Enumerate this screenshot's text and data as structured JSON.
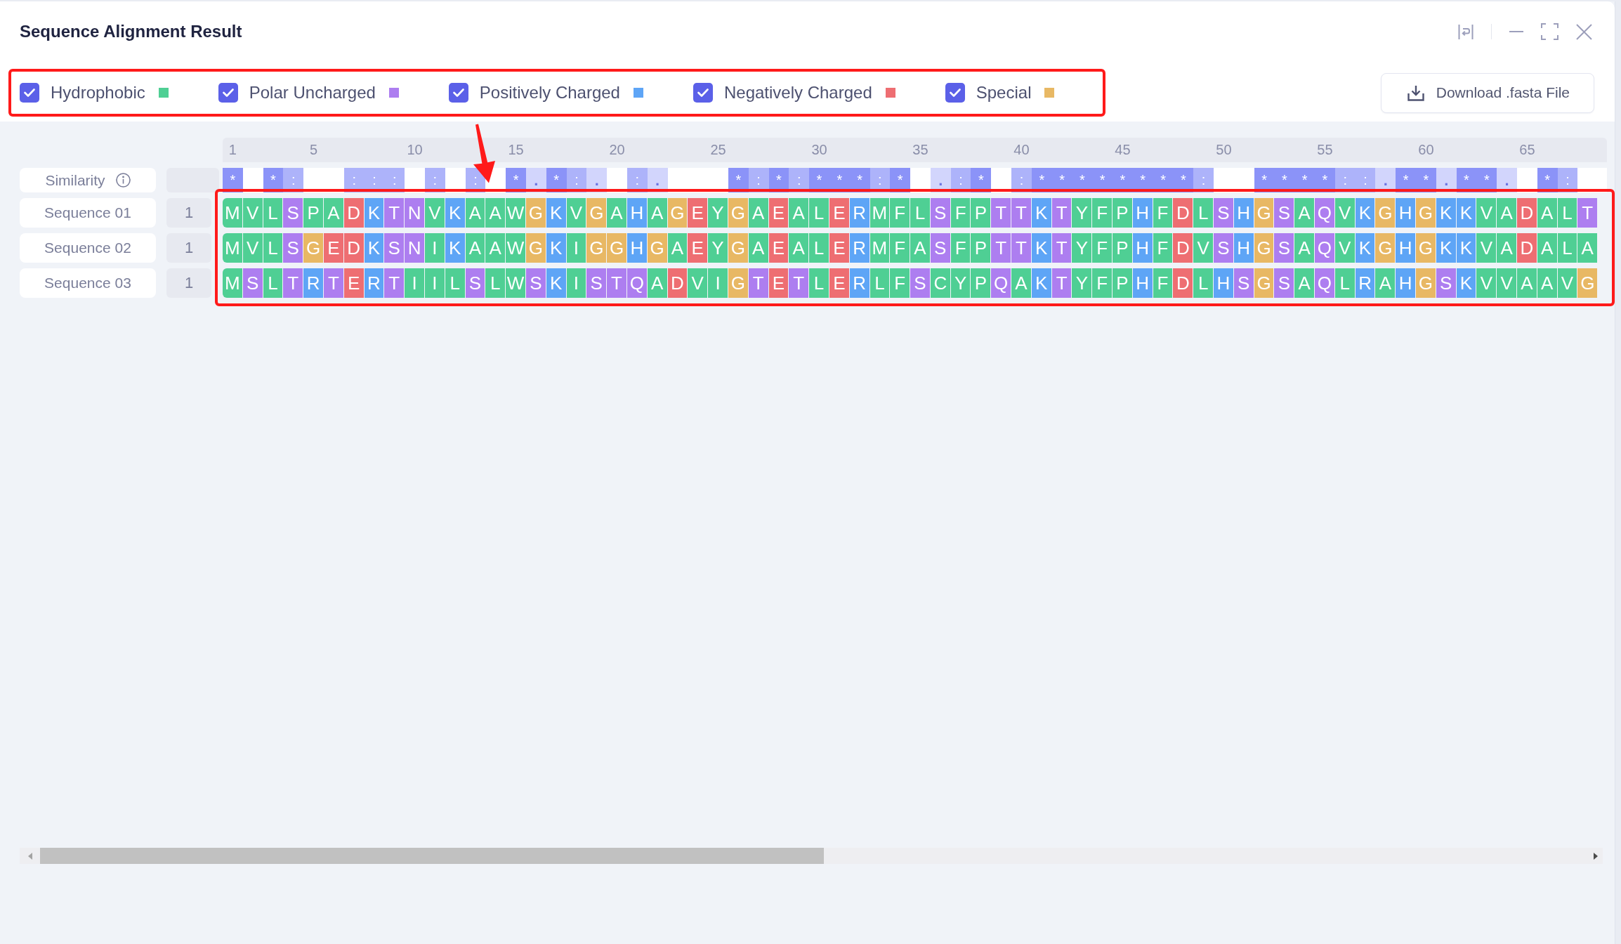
{
  "window": {
    "title": "Sequence Alignment Result"
  },
  "legend": {
    "highlighted": true,
    "items": [
      {
        "label": "Hydrophobic",
        "kind": "hydrophobic",
        "checked": true,
        "color": "#4fcf94"
      },
      {
        "label": "Polar Uncharged",
        "kind": "polar",
        "checked": true,
        "color": "#ad7ef0"
      },
      {
        "label": "Positively Charged",
        "kind": "positive",
        "checked": true,
        "color": "#5ea5f6"
      },
      {
        "label": "Negatively Charged",
        "kind": "negative",
        "checked": true,
        "color": "#ee6e72"
      },
      {
        "label": "Special",
        "kind": "special",
        "checked": true,
        "color": "#e8b864"
      }
    ]
  },
  "download_button": {
    "label": "Download .fasta File"
  },
  "alignment": {
    "highlighted": true,
    "pointer_arrow": true,
    "ruler": [
      "1",
      "5",
      "10",
      "15",
      "20",
      "25",
      "30",
      "35",
      "40",
      "45",
      "50",
      "55",
      "60",
      "65"
    ],
    "similarity": {
      "label": "Similarity",
      "marks": [
        {
          "kind": "identical",
          "mark": "*"
        },
        {
          "kind": "none"
        },
        {
          "kind": "identical",
          "mark": "*"
        },
        {
          "kind": "strong",
          "mark": ":"
        },
        {
          "kind": "none"
        },
        {
          "kind": "none"
        },
        {
          "kind": "strong",
          "mark": ":"
        },
        {
          "kind": "strong",
          "mark": ":"
        },
        {
          "kind": "strong",
          "mark": ":"
        },
        {
          "kind": "none"
        },
        {
          "kind": "strong",
          "mark": ":"
        },
        {
          "kind": "none"
        },
        {
          "kind": "strong",
          "mark": ":"
        },
        {
          "kind": "none"
        },
        {
          "kind": "identical",
          "mark": "*"
        },
        {
          "kind": "weak",
          "mark": "."
        },
        {
          "kind": "identical",
          "mark": "*"
        },
        {
          "kind": "strong",
          "mark": ":"
        },
        {
          "kind": "weak",
          "mark": "."
        },
        {
          "kind": "none"
        },
        {
          "kind": "strong",
          "mark": ":"
        },
        {
          "kind": "weak",
          "mark": "."
        },
        {
          "kind": "none"
        },
        {
          "kind": "none"
        },
        {
          "kind": "none"
        },
        {
          "kind": "identical",
          "mark": "*"
        },
        {
          "kind": "strong",
          "mark": ":"
        },
        {
          "kind": "identical",
          "mark": "*"
        },
        {
          "kind": "strong",
          "mark": ":"
        },
        {
          "kind": "identical",
          "mark": "*"
        },
        {
          "kind": "identical",
          "mark": "*"
        },
        {
          "kind": "identical",
          "mark": "*"
        },
        {
          "kind": "strong",
          "mark": ":"
        },
        {
          "kind": "identical",
          "mark": "*"
        },
        {
          "kind": "none"
        },
        {
          "kind": "weak",
          "mark": "."
        },
        {
          "kind": "strong",
          "mark": ":"
        },
        {
          "kind": "identical",
          "mark": "*"
        },
        {
          "kind": "none"
        },
        {
          "kind": "strong",
          "mark": ":"
        },
        {
          "kind": "identical",
          "mark": "*"
        },
        {
          "kind": "identical",
          "mark": "*"
        },
        {
          "kind": "identical",
          "mark": "*"
        },
        {
          "kind": "identical",
          "mark": "*"
        },
        {
          "kind": "identical",
          "mark": "*"
        },
        {
          "kind": "identical",
          "mark": "*"
        },
        {
          "kind": "identical",
          "mark": "*"
        },
        {
          "kind": "identical",
          "mark": "*"
        },
        {
          "kind": "strong",
          "mark": ":"
        },
        {
          "kind": "none"
        },
        {
          "kind": "none"
        },
        {
          "kind": "identical",
          "mark": "*"
        },
        {
          "kind": "identical",
          "mark": "*"
        },
        {
          "kind": "identical",
          "mark": "*"
        },
        {
          "kind": "identical",
          "mark": "*"
        },
        {
          "kind": "strong",
          "mark": ":"
        },
        {
          "kind": "strong",
          "mark": ":"
        },
        {
          "kind": "weak",
          "mark": "."
        },
        {
          "kind": "identical",
          "mark": "*"
        },
        {
          "kind": "identical",
          "mark": "*"
        },
        {
          "kind": "weak",
          "mark": "."
        },
        {
          "kind": "identical",
          "mark": "*"
        },
        {
          "kind": "identical",
          "mark": "*"
        },
        {
          "kind": "weak",
          "mark": "."
        },
        {
          "kind": "none"
        },
        {
          "kind": "identical",
          "mark": "*"
        },
        {
          "kind": "strong",
          "mark": ":"
        },
        {
          "kind": "none"
        }
      ]
    },
    "sequences": [
      {
        "name": "Sequence 01",
        "start": "1",
        "residues": [
          {
            "aa": "M",
            "kind": "hydrophobic"
          },
          {
            "aa": "V",
            "kind": "hydrophobic"
          },
          {
            "aa": "L",
            "kind": "hydrophobic"
          },
          {
            "aa": "S",
            "kind": "polar"
          },
          {
            "aa": "P",
            "kind": "hydrophobic"
          },
          {
            "aa": "A",
            "kind": "hydrophobic"
          },
          {
            "aa": "D",
            "kind": "negative"
          },
          {
            "aa": "K",
            "kind": "positive"
          },
          {
            "aa": "T",
            "kind": "polar"
          },
          {
            "aa": "N",
            "kind": "polar"
          },
          {
            "aa": "V",
            "kind": "hydrophobic"
          },
          {
            "aa": "K",
            "kind": "positive"
          },
          {
            "aa": "A",
            "kind": "hydrophobic"
          },
          {
            "aa": "A",
            "kind": "hydrophobic"
          },
          {
            "aa": "W",
            "kind": "hydrophobic"
          },
          {
            "aa": "G",
            "kind": "special"
          },
          {
            "aa": "K",
            "kind": "positive"
          },
          {
            "aa": "V",
            "kind": "hydrophobic"
          },
          {
            "aa": "G",
            "kind": "special"
          },
          {
            "aa": "A",
            "kind": "hydrophobic"
          },
          {
            "aa": "H",
            "kind": "positive"
          },
          {
            "aa": "A",
            "kind": "hydrophobic"
          },
          {
            "aa": "G",
            "kind": "special"
          },
          {
            "aa": "E",
            "kind": "negative"
          },
          {
            "aa": "Y",
            "kind": "hydrophobic"
          },
          {
            "aa": "G",
            "kind": "special"
          },
          {
            "aa": "A",
            "kind": "hydrophobic"
          },
          {
            "aa": "E",
            "kind": "negative"
          },
          {
            "aa": "A",
            "kind": "hydrophobic"
          },
          {
            "aa": "L",
            "kind": "hydrophobic"
          },
          {
            "aa": "E",
            "kind": "negative"
          },
          {
            "aa": "R",
            "kind": "positive"
          },
          {
            "aa": "M",
            "kind": "hydrophobic"
          },
          {
            "aa": "F",
            "kind": "hydrophobic"
          },
          {
            "aa": "L",
            "kind": "hydrophobic"
          },
          {
            "aa": "S",
            "kind": "polar"
          },
          {
            "aa": "F",
            "kind": "hydrophobic"
          },
          {
            "aa": "P",
            "kind": "hydrophobic"
          },
          {
            "aa": "T",
            "kind": "polar"
          },
          {
            "aa": "T",
            "kind": "polar"
          },
          {
            "aa": "K",
            "kind": "positive"
          },
          {
            "aa": "T",
            "kind": "polar"
          },
          {
            "aa": "Y",
            "kind": "hydrophobic"
          },
          {
            "aa": "F",
            "kind": "hydrophobic"
          },
          {
            "aa": "P",
            "kind": "hydrophobic"
          },
          {
            "aa": "H",
            "kind": "positive"
          },
          {
            "aa": "F",
            "kind": "hydrophobic"
          },
          {
            "aa": "D",
            "kind": "negative"
          },
          {
            "aa": "L",
            "kind": "hydrophobic"
          },
          {
            "aa": "S",
            "kind": "polar"
          },
          {
            "aa": "H",
            "kind": "positive"
          },
          {
            "aa": "G",
            "kind": "special"
          },
          {
            "aa": "S",
            "kind": "polar"
          },
          {
            "aa": "A",
            "kind": "hydrophobic"
          },
          {
            "aa": "Q",
            "kind": "polar"
          },
          {
            "aa": "V",
            "kind": "hydrophobic"
          },
          {
            "aa": "K",
            "kind": "positive"
          },
          {
            "aa": "G",
            "kind": "special"
          },
          {
            "aa": "H",
            "kind": "positive"
          },
          {
            "aa": "G",
            "kind": "special"
          },
          {
            "aa": "K",
            "kind": "positive"
          },
          {
            "aa": "K",
            "kind": "positive"
          },
          {
            "aa": "V",
            "kind": "hydrophobic"
          },
          {
            "aa": "A",
            "kind": "hydrophobic"
          },
          {
            "aa": "D",
            "kind": "negative"
          },
          {
            "aa": "A",
            "kind": "hydrophobic"
          },
          {
            "aa": "L",
            "kind": "hydrophobic"
          },
          {
            "aa": "T",
            "kind": "polar"
          }
        ]
      },
      {
        "name": "Sequence 02",
        "start": "1",
        "residues": [
          {
            "aa": "M",
            "kind": "hydrophobic"
          },
          {
            "aa": "V",
            "kind": "hydrophobic"
          },
          {
            "aa": "L",
            "kind": "hydrophobic"
          },
          {
            "aa": "S",
            "kind": "polar"
          },
          {
            "aa": "G",
            "kind": "special"
          },
          {
            "aa": "E",
            "kind": "negative"
          },
          {
            "aa": "D",
            "kind": "negative"
          },
          {
            "aa": "K",
            "kind": "positive"
          },
          {
            "aa": "S",
            "kind": "polar"
          },
          {
            "aa": "N",
            "kind": "polar"
          },
          {
            "aa": "I",
            "kind": "hydrophobic"
          },
          {
            "aa": "K",
            "kind": "positive"
          },
          {
            "aa": "A",
            "kind": "hydrophobic"
          },
          {
            "aa": "A",
            "kind": "hydrophobic"
          },
          {
            "aa": "W",
            "kind": "hydrophobic"
          },
          {
            "aa": "G",
            "kind": "special"
          },
          {
            "aa": "K",
            "kind": "positive"
          },
          {
            "aa": "I",
            "kind": "hydrophobic"
          },
          {
            "aa": "G",
            "kind": "special"
          },
          {
            "aa": "G",
            "kind": "special"
          },
          {
            "aa": "H",
            "kind": "positive"
          },
          {
            "aa": "G",
            "kind": "special"
          },
          {
            "aa": "A",
            "kind": "hydrophobic"
          },
          {
            "aa": "E",
            "kind": "negative"
          },
          {
            "aa": "Y",
            "kind": "hydrophobic"
          },
          {
            "aa": "G",
            "kind": "special"
          },
          {
            "aa": "A",
            "kind": "hydrophobic"
          },
          {
            "aa": "E",
            "kind": "negative"
          },
          {
            "aa": "A",
            "kind": "hydrophobic"
          },
          {
            "aa": "L",
            "kind": "hydrophobic"
          },
          {
            "aa": "E",
            "kind": "negative"
          },
          {
            "aa": "R",
            "kind": "positive"
          },
          {
            "aa": "M",
            "kind": "hydrophobic"
          },
          {
            "aa": "F",
            "kind": "hydrophobic"
          },
          {
            "aa": "A",
            "kind": "hydrophobic"
          },
          {
            "aa": "S",
            "kind": "polar"
          },
          {
            "aa": "F",
            "kind": "hydrophobic"
          },
          {
            "aa": "P",
            "kind": "hydrophobic"
          },
          {
            "aa": "T",
            "kind": "polar"
          },
          {
            "aa": "T",
            "kind": "polar"
          },
          {
            "aa": "K",
            "kind": "positive"
          },
          {
            "aa": "T",
            "kind": "polar"
          },
          {
            "aa": "Y",
            "kind": "hydrophobic"
          },
          {
            "aa": "F",
            "kind": "hydrophobic"
          },
          {
            "aa": "P",
            "kind": "hydrophobic"
          },
          {
            "aa": "H",
            "kind": "positive"
          },
          {
            "aa": "F",
            "kind": "hydrophobic"
          },
          {
            "aa": "D",
            "kind": "negative"
          },
          {
            "aa": "V",
            "kind": "hydrophobic"
          },
          {
            "aa": "S",
            "kind": "polar"
          },
          {
            "aa": "H",
            "kind": "positive"
          },
          {
            "aa": "G",
            "kind": "special"
          },
          {
            "aa": "S",
            "kind": "polar"
          },
          {
            "aa": "A",
            "kind": "hydrophobic"
          },
          {
            "aa": "Q",
            "kind": "polar"
          },
          {
            "aa": "V",
            "kind": "hydrophobic"
          },
          {
            "aa": "K",
            "kind": "positive"
          },
          {
            "aa": "G",
            "kind": "special"
          },
          {
            "aa": "H",
            "kind": "positive"
          },
          {
            "aa": "G",
            "kind": "special"
          },
          {
            "aa": "K",
            "kind": "positive"
          },
          {
            "aa": "K",
            "kind": "positive"
          },
          {
            "aa": "V",
            "kind": "hydrophobic"
          },
          {
            "aa": "A",
            "kind": "hydrophobic"
          },
          {
            "aa": "D",
            "kind": "negative"
          },
          {
            "aa": "A",
            "kind": "hydrophobic"
          },
          {
            "aa": "L",
            "kind": "hydrophobic"
          },
          {
            "aa": "A",
            "kind": "hydrophobic"
          }
        ]
      },
      {
        "name": "Sequence 03",
        "start": "1",
        "residues": [
          {
            "aa": "M",
            "kind": "hydrophobic"
          },
          {
            "aa": "S",
            "kind": "polar"
          },
          {
            "aa": "L",
            "kind": "hydrophobic"
          },
          {
            "aa": "T",
            "kind": "polar"
          },
          {
            "aa": "R",
            "kind": "positive"
          },
          {
            "aa": "T",
            "kind": "polar"
          },
          {
            "aa": "E",
            "kind": "negative"
          },
          {
            "aa": "R",
            "kind": "positive"
          },
          {
            "aa": "T",
            "kind": "polar"
          },
          {
            "aa": "I",
            "kind": "hydrophobic"
          },
          {
            "aa": "I",
            "kind": "hydrophobic"
          },
          {
            "aa": "L",
            "kind": "hydrophobic"
          },
          {
            "aa": "S",
            "kind": "polar"
          },
          {
            "aa": "L",
            "kind": "hydrophobic"
          },
          {
            "aa": "W",
            "kind": "hydrophobic"
          },
          {
            "aa": "S",
            "kind": "polar"
          },
          {
            "aa": "K",
            "kind": "positive"
          },
          {
            "aa": "I",
            "kind": "hydrophobic"
          },
          {
            "aa": "S",
            "kind": "polar"
          },
          {
            "aa": "T",
            "kind": "polar"
          },
          {
            "aa": "Q",
            "kind": "polar"
          },
          {
            "aa": "A",
            "kind": "hydrophobic"
          },
          {
            "aa": "D",
            "kind": "negative"
          },
          {
            "aa": "V",
            "kind": "hydrophobic"
          },
          {
            "aa": "I",
            "kind": "hydrophobic"
          },
          {
            "aa": "G",
            "kind": "special"
          },
          {
            "aa": "T",
            "kind": "polar"
          },
          {
            "aa": "E",
            "kind": "negative"
          },
          {
            "aa": "T",
            "kind": "polar"
          },
          {
            "aa": "L",
            "kind": "hydrophobic"
          },
          {
            "aa": "E",
            "kind": "negative"
          },
          {
            "aa": "R",
            "kind": "positive"
          },
          {
            "aa": "L",
            "kind": "hydrophobic"
          },
          {
            "aa": "F",
            "kind": "hydrophobic"
          },
          {
            "aa": "S",
            "kind": "polar"
          },
          {
            "aa": "C",
            "kind": "hydrophobic"
          },
          {
            "aa": "Y",
            "kind": "hydrophobic"
          },
          {
            "aa": "P",
            "kind": "hydrophobic"
          },
          {
            "aa": "Q",
            "kind": "polar"
          },
          {
            "aa": "A",
            "kind": "hydrophobic"
          },
          {
            "aa": "K",
            "kind": "positive"
          },
          {
            "aa": "T",
            "kind": "polar"
          },
          {
            "aa": "Y",
            "kind": "hydrophobic"
          },
          {
            "aa": "F",
            "kind": "hydrophobic"
          },
          {
            "aa": "P",
            "kind": "hydrophobic"
          },
          {
            "aa": "H",
            "kind": "positive"
          },
          {
            "aa": "F",
            "kind": "hydrophobic"
          },
          {
            "aa": "D",
            "kind": "negative"
          },
          {
            "aa": "L",
            "kind": "hydrophobic"
          },
          {
            "aa": "H",
            "kind": "positive"
          },
          {
            "aa": "S",
            "kind": "polar"
          },
          {
            "aa": "G",
            "kind": "special"
          },
          {
            "aa": "S",
            "kind": "polar"
          },
          {
            "aa": "A",
            "kind": "hydrophobic"
          },
          {
            "aa": "Q",
            "kind": "polar"
          },
          {
            "aa": "L",
            "kind": "hydrophobic"
          },
          {
            "aa": "R",
            "kind": "positive"
          },
          {
            "aa": "A",
            "kind": "hydrophobic"
          },
          {
            "aa": "H",
            "kind": "positive"
          },
          {
            "aa": "G",
            "kind": "special"
          },
          {
            "aa": "S",
            "kind": "polar"
          },
          {
            "aa": "K",
            "kind": "positive"
          },
          {
            "aa": "V",
            "kind": "hydrophobic"
          },
          {
            "aa": "V",
            "kind": "hydrophobic"
          },
          {
            "aa": "A",
            "kind": "hydrophobic"
          },
          {
            "aa": "A",
            "kind": "hydrophobic"
          },
          {
            "aa": "V",
            "kind": "hydrophobic"
          },
          {
            "aa": "G",
            "kind": "special"
          }
        ]
      }
    ]
  }
}
